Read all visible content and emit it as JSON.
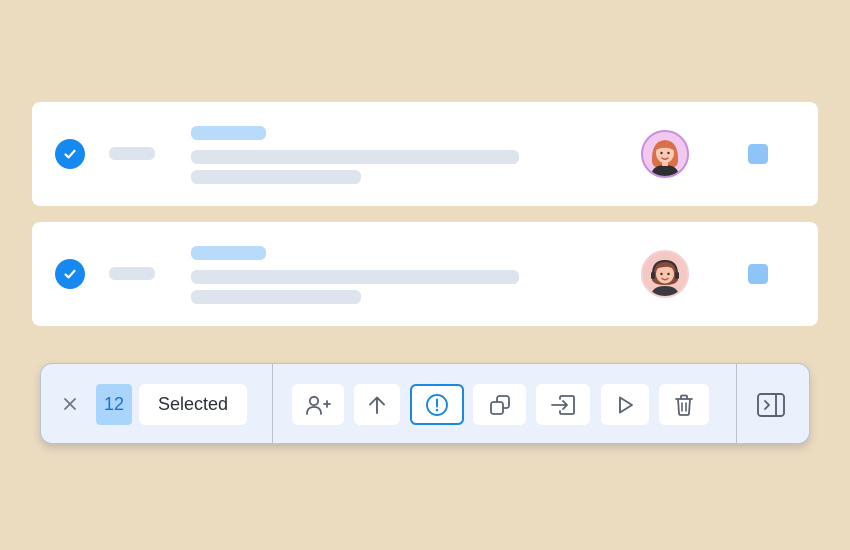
{
  "rows": [
    {
      "selected": true,
      "avatar": "woman-avatar-icon",
      "status_color": "#8ec4f8"
    },
    {
      "selected": true,
      "avatar": "woman-headset-avatar-icon",
      "status_color": "#8ec4f8"
    }
  ],
  "toolbar": {
    "selected_count": "12",
    "selected_label": "Selected",
    "actions": [
      {
        "icon": "add-user-icon"
      },
      {
        "icon": "arrow-up-icon"
      },
      {
        "icon": "alert-icon",
        "active": true
      },
      {
        "icon": "duplicate-icon"
      },
      {
        "icon": "move-to-icon"
      },
      {
        "icon": "play-icon"
      },
      {
        "icon": "trash-icon"
      }
    ],
    "panel_toggle_icon": "panel-toggle-icon"
  },
  "colors": {
    "background": "#ebdbbf",
    "accent": "#1689f0",
    "toolbar_bg": "#eaf1fd",
    "count_bg": "#a9d4fb"
  }
}
